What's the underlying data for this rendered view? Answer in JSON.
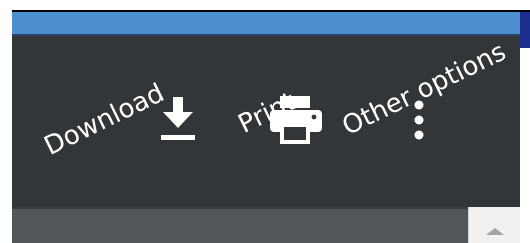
{
  "toolbar": {
    "buttons": [
      {
        "icon": "download-icon",
        "annotation": "Download"
      },
      {
        "icon": "print-icon",
        "annotation": "Print"
      },
      {
        "icon": "more-vert-icon",
        "annotation": "Other options"
      }
    ]
  },
  "colors": {
    "toolbar_bg": "#323639",
    "title_bar": "#4b8fce",
    "title_bar_dark": "#1d2f8e",
    "viewer_bg": "#525659",
    "annotation_text": "#ffffff",
    "icon": "#ffffff",
    "scroll_arrow": "#a3a3a3"
  },
  "scrollbar": {
    "up_icon": "scroll-up-arrow-icon"
  }
}
